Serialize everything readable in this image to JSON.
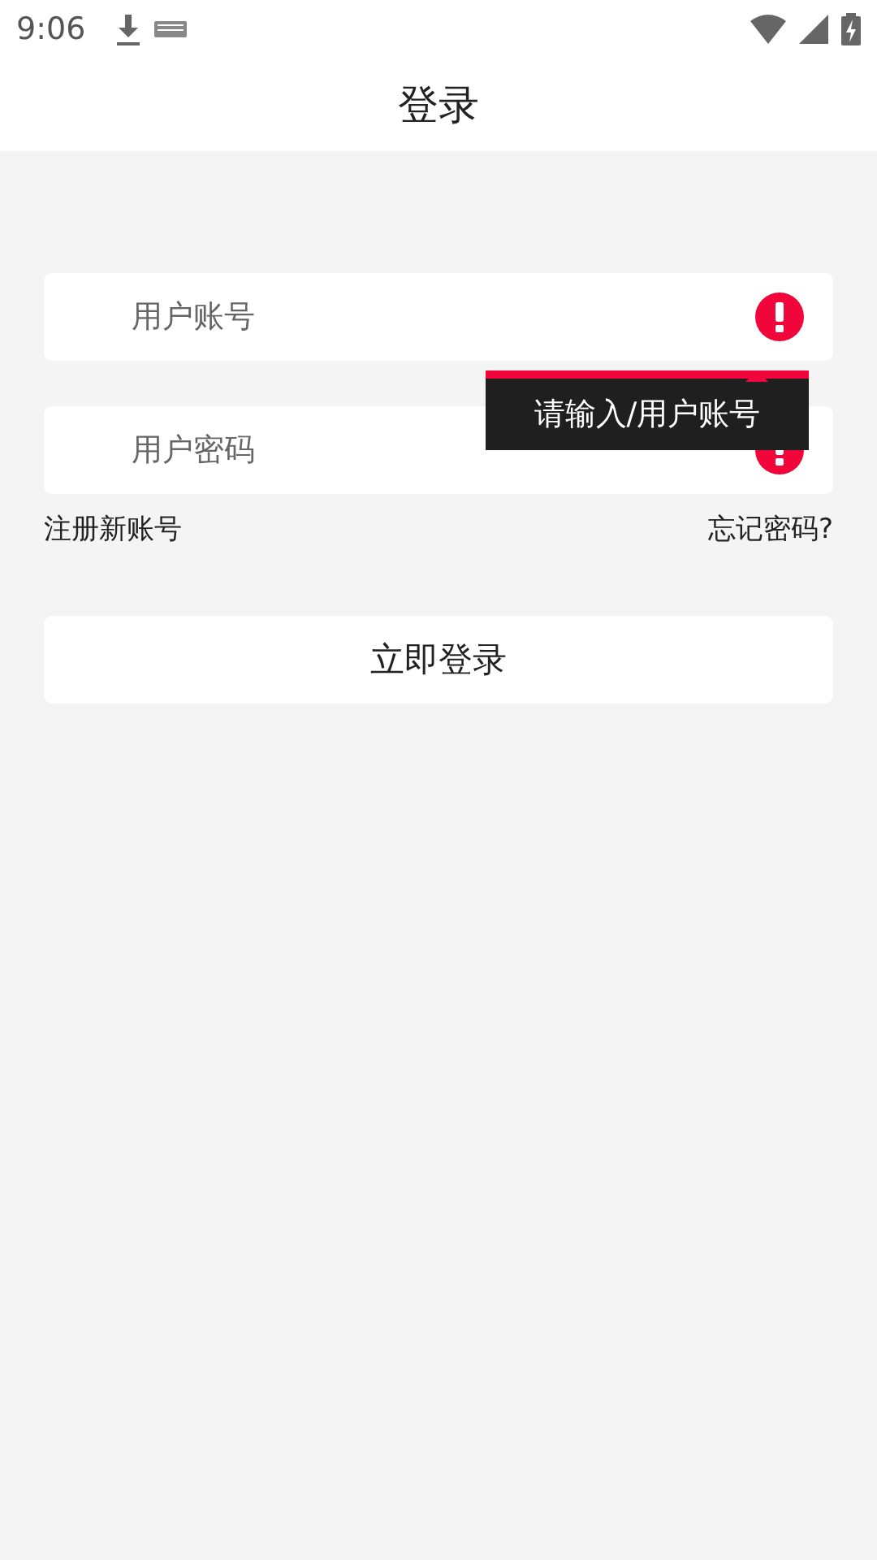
{
  "status_bar": {
    "time": "9:06"
  },
  "header": {
    "title": "登录"
  },
  "fields": [
    {
      "placeholder": "用户账号",
      "error": true
    },
    {
      "placeholder": "用户密码",
      "error": true
    }
  ],
  "tooltip": {
    "text": "请输入/用户账号"
  },
  "links": {
    "register": "注册新账号",
    "forgot": "忘记密码?"
  },
  "login_button": "立即登录"
}
